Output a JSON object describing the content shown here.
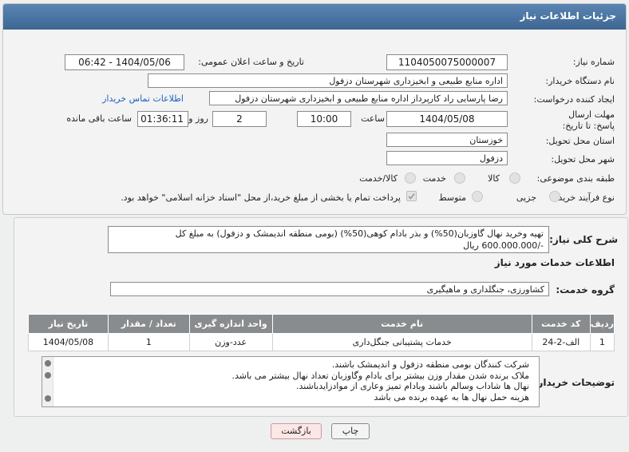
{
  "header": {
    "title": "جزئیات اطلاعات نیاز"
  },
  "form": {
    "need_number": {
      "label": "شماره نیاز:",
      "value": "1104050075000007"
    },
    "announce_datetime": {
      "label": "تاریخ و ساعت اعلان عمومی:",
      "value": "1404/05/06 - 06:42"
    },
    "buyer_org": {
      "label": "نام دستگاه خریدار:",
      "value": "اداره منابع طبیعی و ابخیزداری شهرستان دزفول"
    },
    "creator": {
      "label": "ایجاد کننده درخواست:",
      "value": "رضا پارسایی راد کارپرداز اداره منابع طبیعی و ابخیزداری شهرستان دزفول",
      "contact_link": "اطلاعات تماس خریدار"
    },
    "deadline": {
      "label": "مهلت ارسال پاسخ: تا تاریخ:",
      "date": "1404/05/08",
      "time_label": "ساعت",
      "time": "10:00",
      "days": "2",
      "days_label": "روز و",
      "remaining": "01:36:11",
      "remaining_label": "ساعت باقی مانده"
    },
    "province": {
      "label": "استان محل تحویل:",
      "value": "خوزستان"
    },
    "city": {
      "label": "شهر محل تحویل:",
      "value": "دزفول"
    },
    "category": {
      "label": "طبقه بندی موضوعی:",
      "options": [
        "کالا",
        "خدمت",
        "کالا/خدمت"
      ]
    },
    "purchase_type": {
      "label": "نوع فرآیند خرید :",
      "options": [
        "جزیی",
        "متوسط"
      ],
      "payment_note": "پرداخت تمام یا بخشی از مبلغ خرید،از محل \"اسناد خزانه اسلامی\" خواهد بود."
    }
  },
  "summary": {
    "label": "شرح کلی نیاز:",
    "text": "تهیه وخرید نهال گاوزبان(50%) و بذر بادام کوهی(50%) (بومی منطقه اندیمشک و دزفول) به مبلغ کل -/600.000.000 ریال"
  },
  "services": {
    "section_title": "اطلاعات خدمات مورد نیاز",
    "group_label": "گروه خدمت:",
    "group_value": "کشاورزی، جنگلداری و ماهیگیری",
    "table": {
      "headers": [
        "ردیف",
        "کد خدمت",
        "نام خدمت",
        "واحد اندازه گیری",
        "تعداد / مقدار",
        "تاریخ نیاز"
      ],
      "rows": [
        [
          "1",
          "الف-2-24",
          "خدمات پشتیبانی جنگل‌داری",
          "عدد-وزن",
          "1",
          "1404/05/08"
        ]
      ]
    }
  },
  "buyer_notes": {
    "label": "توضیحات خریدار:",
    "lines": [
      "شرکت کنندگان بومی منطقه دزفول و اندیمشک باشند.",
      "ملاک برنده شدن مقدار وزن بیشتر برای بادام وگاوزبان تعداد نهال بیشتر می باشد.",
      "نهال ها شاداب وسالم باشند وبادام تمیز وعاری از موادزایدباشند.",
      "هزینه حمل نهال ها به عهده برنده می باشد"
    ]
  },
  "buttons": {
    "print": "چاپ",
    "back": "بازگشت"
  },
  "watermark": {
    "text": "AriaTender.net"
  },
  "colors": {
    "header": "#4a76a4",
    "link": "#1c62c4",
    "table_header": "#888c8e",
    "back_button": "#fde6e6"
  }
}
